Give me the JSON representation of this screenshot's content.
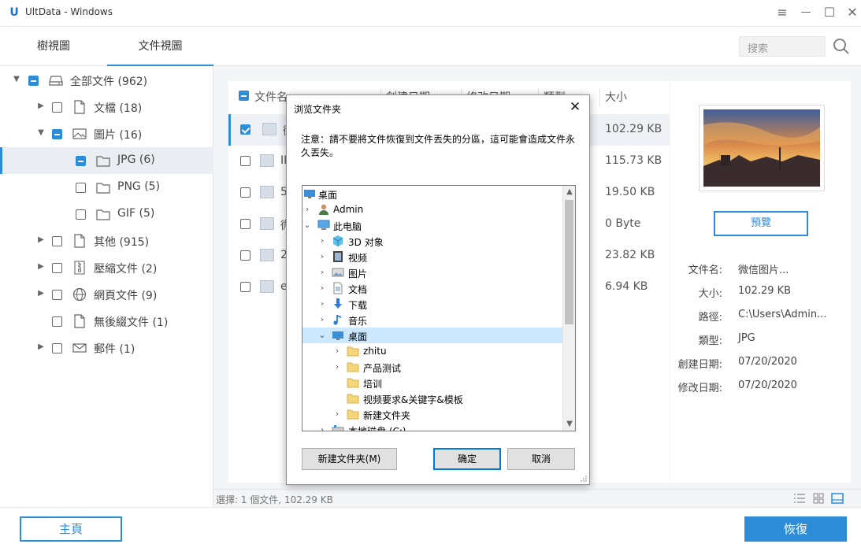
{
  "window": {
    "title": "UltData - Windows",
    "logo_text": "U",
    "menu_icon": "≡",
    "minimize_icon": "—",
    "maximize_icon": "☐",
    "close_icon": "✕"
  },
  "tabs": [
    {
      "label": "樹視圖",
      "active": false
    },
    {
      "label": "文件視圖",
      "active": true
    }
  ],
  "tree": [
    {
      "label": "全部文件 (962)",
      "icon": "drive-icon",
      "check": "partial",
      "arrow": "▼"
    },
    {
      "label": "文檔 (18)",
      "icon": "document-icon",
      "check": "none",
      "arrow": "▶"
    },
    {
      "label": "圖片 (16)",
      "icon": "image-icon",
      "check": "partial",
      "arrow": "▼"
    },
    {
      "label": "JPG (6)",
      "icon": "folder-icon",
      "check": "partial",
      "arrow": ""
    },
    {
      "label": "PNG (5)",
      "icon": "folder-icon",
      "check": "none",
      "arrow": ""
    },
    {
      "label": "GIF (5)",
      "icon": "folder-icon",
      "check": "none",
      "arrow": ""
    },
    {
      "label": "其他 (915)",
      "icon": "document-icon",
      "check": "none",
      "arrow": "▶"
    },
    {
      "label": "壓縮文件 (2)",
      "icon": "archive-icon",
      "check": "none",
      "arrow": "▶"
    },
    {
      "label": "網頁文件 (9)",
      "icon": "globe-icon",
      "check": "none",
      "arrow": "▶"
    },
    {
      "label": "無後綴文件 (1)",
      "icon": "document-icon",
      "check": "none",
      "arrow": ""
    },
    {
      "label": "郵件 (1)",
      "icon": "mail-icon",
      "check": "none",
      "arrow": "▶"
    }
  ],
  "search": {
    "placeholder": "搜索"
  },
  "table": {
    "headers": {
      "name": "文件名",
      "created": "創建日期",
      "modified": "修改日期",
      "type": "類型",
      "size": "大小"
    },
    "rows": [
      {
        "name": "微",
        "size": "102.29 KB",
        "checked": true
      },
      {
        "name": "II",
        "size": "115.73 KB",
        "checked": false
      },
      {
        "name": "5",
        "size": "19.50 KB",
        "checked": false
      },
      {
        "name": "微",
        "size": "0 Byte",
        "checked": false
      },
      {
        "name": "2",
        "size": "23.82 KB",
        "checked": false
      },
      {
        "name": "e",
        "size": "6.94 KB",
        "checked": false
      }
    ]
  },
  "preview": {
    "button": "預覽",
    "meta": [
      {
        "key": "文件名:",
        "value": "微信图片..."
      },
      {
        "key": "大小:",
        "value": "102.29 KB"
      },
      {
        "key": "路徑:",
        "value": "C:\\Users\\Admin..."
      },
      {
        "key": "類型:",
        "value": "JPG"
      },
      {
        "key": "創建日期:",
        "value": "07/20/2020"
      },
      {
        "key": "修改日期:",
        "value": "07/20/2020"
      }
    ]
  },
  "status": {
    "text": "選擇: 1 個文件, 102.29 KB"
  },
  "bottom": {
    "home": "主頁",
    "recover": "恢復"
  },
  "dialog": {
    "title": "浏览文件夹",
    "close": "✕",
    "note": "注意：請不要將文件恢復到文件丟失的分區，這可能會造成文件永久丟失。",
    "tree": [
      {
        "label": "桌面",
        "depth": 0,
        "arrow": "",
        "icon": "desktop-icon",
        "selected": false
      },
      {
        "label": "Admin",
        "depth": 1,
        "arrow": "›",
        "icon": "user-icon",
        "selected": false
      },
      {
        "label": "此电脑",
        "depth": 1,
        "arrow": "⌄",
        "icon": "computer-icon",
        "selected": false
      },
      {
        "label": "3D 对象",
        "depth": 2,
        "arrow": "›",
        "icon": "cube-icon",
        "selected": false
      },
      {
        "label": "视频",
        "depth": 2,
        "arrow": "›",
        "icon": "video-icon",
        "selected": false
      },
      {
        "label": "图片",
        "depth": 2,
        "arrow": "›",
        "icon": "pictures-icon",
        "selected": false
      },
      {
        "label": "文档",
        "depth": 2,
        "arrow": "›",
        "icon": "documents-icon",
        "selected": false
      },
      {
        "label": "下载",
        "depth": 2,
        "arrow": "›",
        "icon": "download-icon",
        "selected": false
      },
      {
        "label": "音乐",
        "depth": 2,
        "arrow": "›",
        "icon": "music-icon",
        "selected": false
      },
      {
        "label": "桌面",
        "depth": 2,
        "arrow": "⌄",
        "icon": "desktop-icon",
        "selected": true
      },
      {
        "label": "zhitu",
        "depth": 3,
        "arrow": "›",
        "icon": "folder-icon",
        "selected": false
      },
      {
        "label": "产品测试",
        "depth": 3,
        "arrow": "›",
        "icon": "folder-icon",
        "selected": false
      },
      {
        "label": "培训",
        "depth": 3,
        "arrow": "",
        "icon": "folder-icon",
        "selected": false
      },
      {
        "label": "视频要求&关键字&模板",
        "depth": 3,
        "arrow": "",
        "icon": "folder-icon",
        "selected": false
      },
      {
        "label": "新建文件夹",
        "depth": 3,
        "arrow": "›",
        "icon": "folder-icon",
        "selected": false
      },
      {
        "label": "本地磁盘 (C:)",
        "depth": 2,
        "arrow": "›",
        "icon": "disk-icon",
        "selected": false
      }
    ],
    "buttons": {
      "new_folder": "新建文件夹(M)",
      "ok": "确定",
      "cancel": "取消"
    }
  }
}
